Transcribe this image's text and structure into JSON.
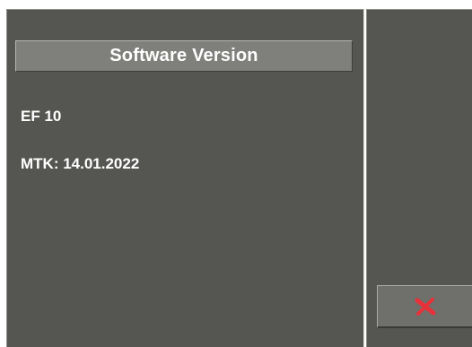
{
  "dialog": {
    "title": "Software Version",
    "lines": [
      "EF 10",
      "MTK: 14.01.2022"
    ]
  },
  "close_button": {
    "icon": "close-icon",
    "icon_color": "#e8323a"
  },
  "colors": {
    "panel_background": "#555552",
    "title_bar_background": "#7f7f7c",
    "text": "#ffffff"
  }
}
